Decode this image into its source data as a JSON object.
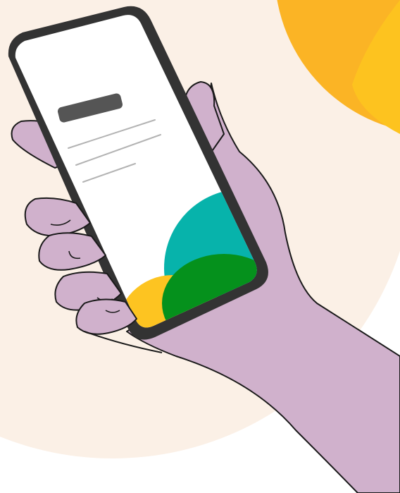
{
  "illustration": {
    "subject": "hand-holding-smartphone",
    "colors": {
      "background": "#ffffff",
      "peach_circle": "#fbf0e6",
      "sun_outer": "#fbb425",
      "sun_inner": "#fdc31f",
      "skin": "#d0b1cc",
      "outline": "#1a1a1a",
      "phone_body": "#333333",
      "screen": "#ffffff",
      "title_bar": "#555555",
      "text_lines": "#b3b3b3",
      "teal_blob": "#07b3ab",
      "green_blob": "#05911c",
      "yellow_blob": "#fdc421"
    }
  }
}
